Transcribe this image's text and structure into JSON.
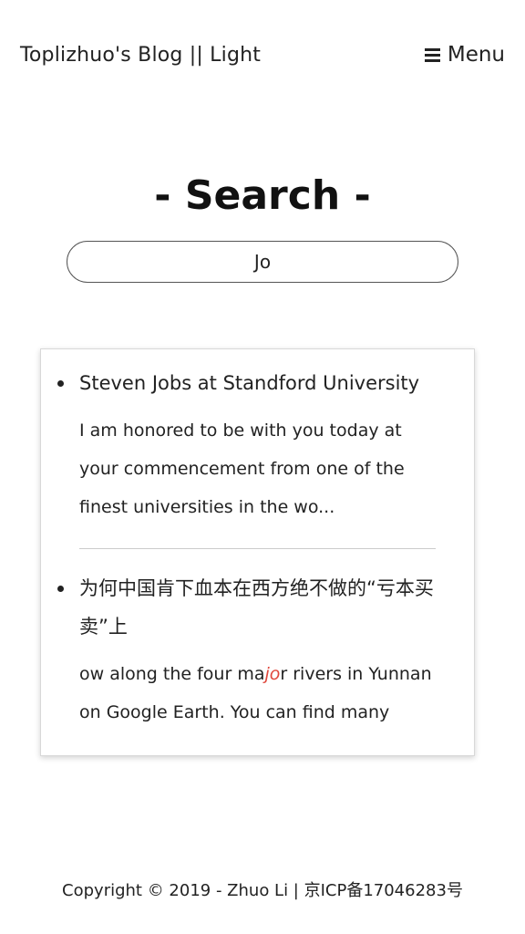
{
  "header": {
    "site_title": "Toplizhuo's Blog || Light",
    "menu_label": "Menu",
    "menu_icon": "hamburger-icon"
  },
  "page": {
    "heading": "- Search -"
  },
  "search": {
    "value": "Jo",
    "placeholder": ""
  },
  "results": [
    {
      "title": "Steven Jobs at Standford University",
      "snippet": "I am honored to be with you today at your commencement from one of the finest universities in the wo..."
    },
    {
      "title": "为何中国肯下血本在西方绝不做的“亏本买卖”上",
      "snippet_before": "ow along the four ma",
      "snippet_match": "jo",
      "snippet_after": "r rivers in Yunnan on Google Earth. You can find many"
    }
  ],
  "colors": {
    "highlight": "#e0483d",
    "text": "#222222"
  },
  "footer": {
    "text": "Copyright © 2019 - Zhuo Li | 京ICP备17046283号"
  }
}
